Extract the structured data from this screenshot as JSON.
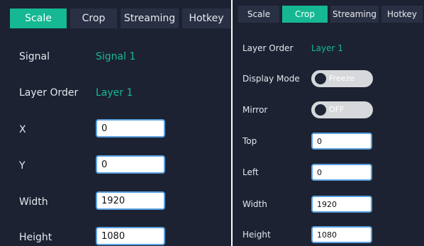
{
  "scale_panel": {
    "tabs": [
      {
        "label": "Scale"
      },
      {
        "label": "Crop"
      },
      {
        "label": "Streaming"
      },
      {
        "label": "Hotkey"
      }
    ],
    "active_tab": "Scale",
    "signal": {
      "label": "Signal",
      "value": "Signal  1"
    },
    "layer_order": {
      "label": "Layer Order",
      "value": "Layer 1"
    },
    "x": {
      "label": "X",
      "value": "0"
    },
    "y": {
      "label": "Y",
      "value": "0"
    },
    "width": {
      "label": "Width",
      "value": "1920"
    },
    "height": {
      "label": "Height",
      "value": "1080"
    }
  },
  "crop_panel": {
    "tabs": [
      {
        "label": "Scale"
      },
      {
        "label": "Crop"
      },
      {
        "label": "Streaming"
      },
      {
        "label": "Hotkey"
      }
    ],
    "active_tab": "Crop",
    "layer_order": {
      "label": "Layer Order",
      "value": "Layer 1"
    },
    "display_mode": {
      "label": "Display Mode",
      "value": "Freeze"
    },
    "mirror": {
      "label": "Mirror",
      "value": "OFF"
    },
    "top": {
      "label": "Top",
      "value": "0"
    },
    "left": {
      "label": "Left",
      "value": "0"
    },
    "width": {
      "label": "Width",
      "value": "1920"
    },
    "height": {
      "label": "Height",
      "value": "1080"
    }
  },
  "colors": {
    "panel_bg": "#1c2231",
    "tab_bg": "#2a3043",
    "accent": "#15b892",
    "value_text": "#19b897",
    "input_border": "#5aa0e0",
    "toggle_bg": "#d6d8dc"
  }
}
